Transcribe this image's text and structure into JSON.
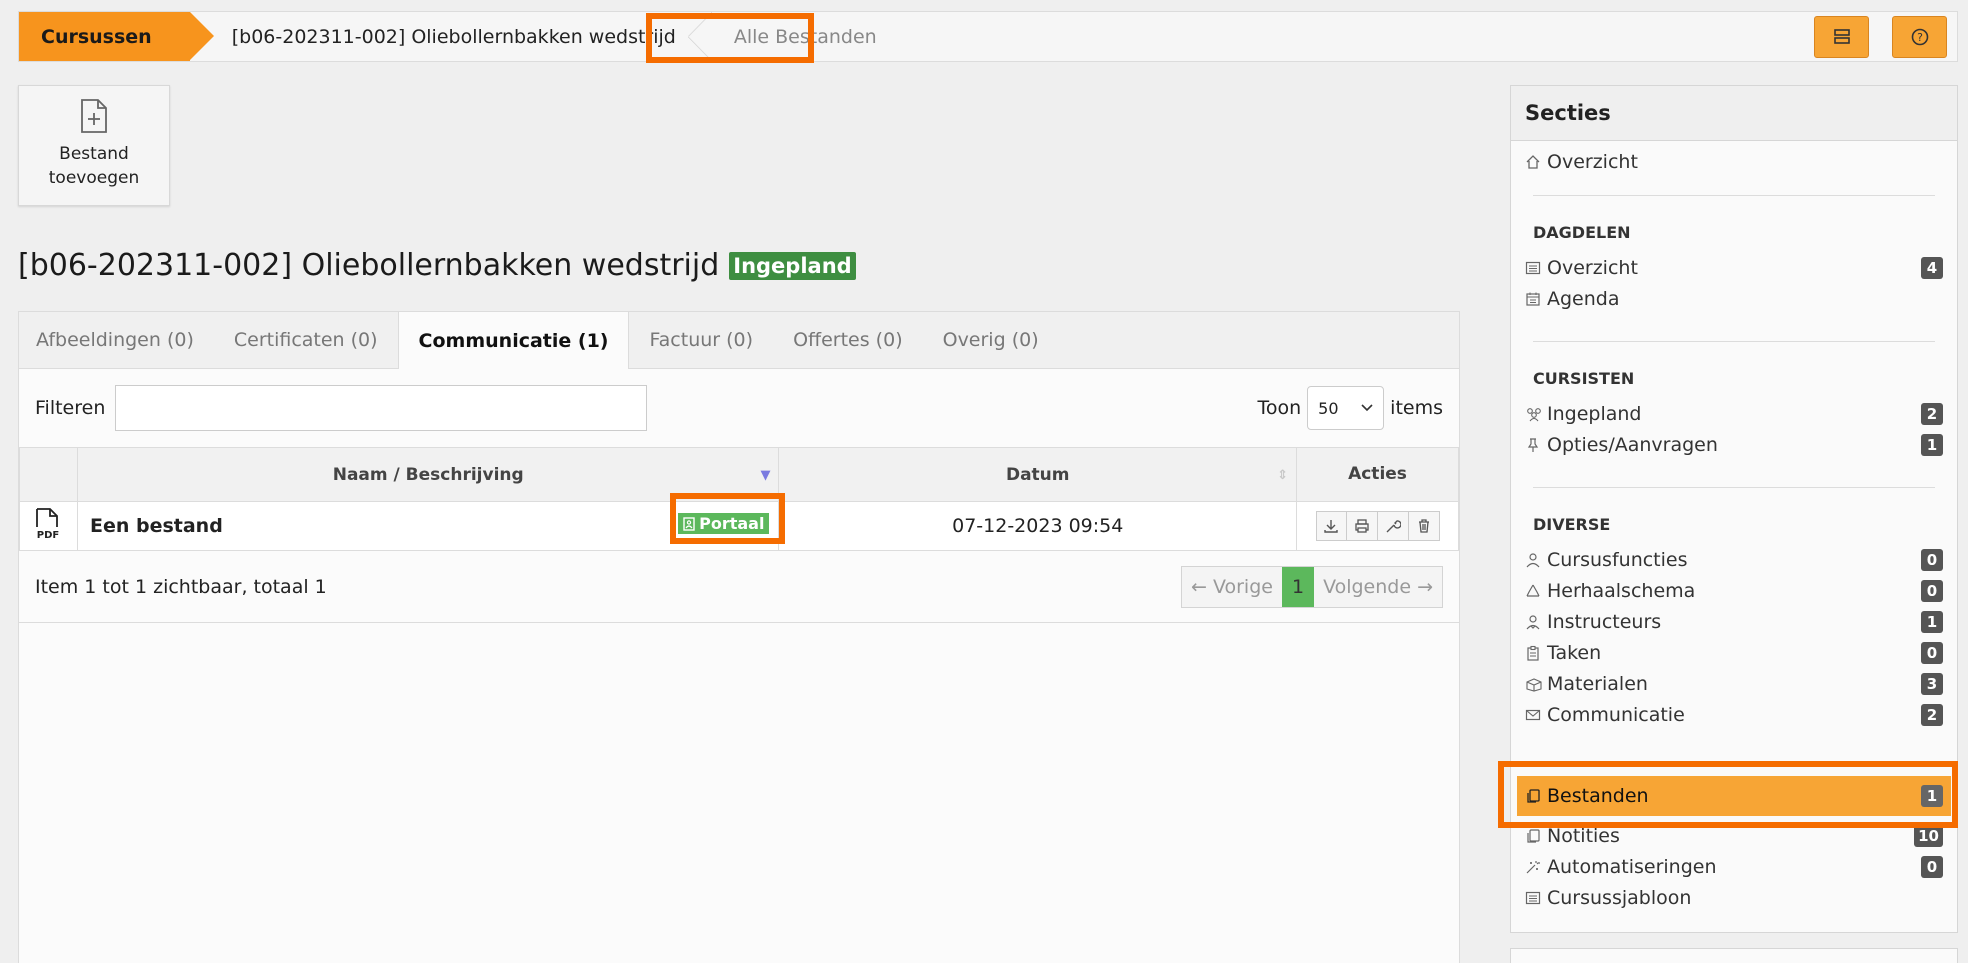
{
  "breadcrumb": {
    "root": "Cursussen",
    "course": "[b06-202311-002] Oliebollernbakken wedstrijd",
    "current": "Alle Bestanden"
  },
  "toolbar": {
    "add_file_line1": "Bestand",
    "add_file_line2": "toevoegen"
  },
  "page": {
    "title": "[b06-202311-002] Oliebollernbakken wedstrijd",
    "status": "Ingepland"
  },
  "tabs": [
    {
      "label": "Afbeeldingen (0)"
    },
    {
      "label": "Certificaten (0)"
    },
    {
      "label": "Communicatie (1)"
    },
    {
      "label": "Factuur (0)"
    },
    {
      "label": "Offertes (0)"
    },
    {
      "label": "Overig (0)"
    }
  ],
  "filter": {
    "label": "Filteren",
    "toon_label": "Toon",
    "page_size": "50",
    "items_label": "items"
  },
  "table": {
    "headers": {
      "name": "Naam / Beschrijving",
      "date": "Datum",
      "actions": "Acties"
    },
    "rows": [
      {
        "icon": "pdf-icon",
        "icon_label": "PDF",
        "name": "Een bestand",
        "tag": "Portaal",
        "date": "07-12-2023 09:54"
      }
    ]
  },
  "pagination": {
    "summary": "Item 1 tot 1 zichtbaar, totaal 1",
    "prev": "← Vorige",
    "page": "1",
    "next": "Volgende →"
  },
  "sidebar": {
    "title": "Secties",
    "overview": "Overzicht",
    "sections": {
      "dagdelen": "DAGDELEN",
      "cursisten": "CURSISTEN",
      "diverse": "DIVERSE"
    },
    "dagdelen": [
      {
        "label": "Overzicht",
        "count": "4"
      },
      {
        "label": "Agenda",
        "count": ""
      }
    ],
    "cursisten": [
      {
        "label": "Ingepland",
        "count": "2"
      },
      {
        "label": "Opties/Aanvragen",
        "count": "1"
      }
    ],
    "diverse": [
      {
        "label": "Cursusfuncties",
        "count": "0"
      },
      {
        "label": "Herhaalschema",
        "count": "0"
      },
      {
        "label": "Instructeurs",
        "count": "1"
      },
      {
        "label": "Taken",
        "count": "0"
      },
      {
        "label": "Materialen",
        "count": "3"
      },
      {
        "label": "Communicatie",
        "count": "2"
      },
      {
        "label": "Bestanden",
        "count": "1"
      },
      {
        "label": "Notities",
        "count": "10"
      },
      {
        "label": "Automatiseringen",
        "count": "0"
      },
      {
        "label": "Cursussjabloon",
        "count": ""
      }
    ]
  },
  "colors": {
    "accent": "#f7941d",
    "highlight": "#f56c00",
    "status_green": "#3e8e41"
  }
}
